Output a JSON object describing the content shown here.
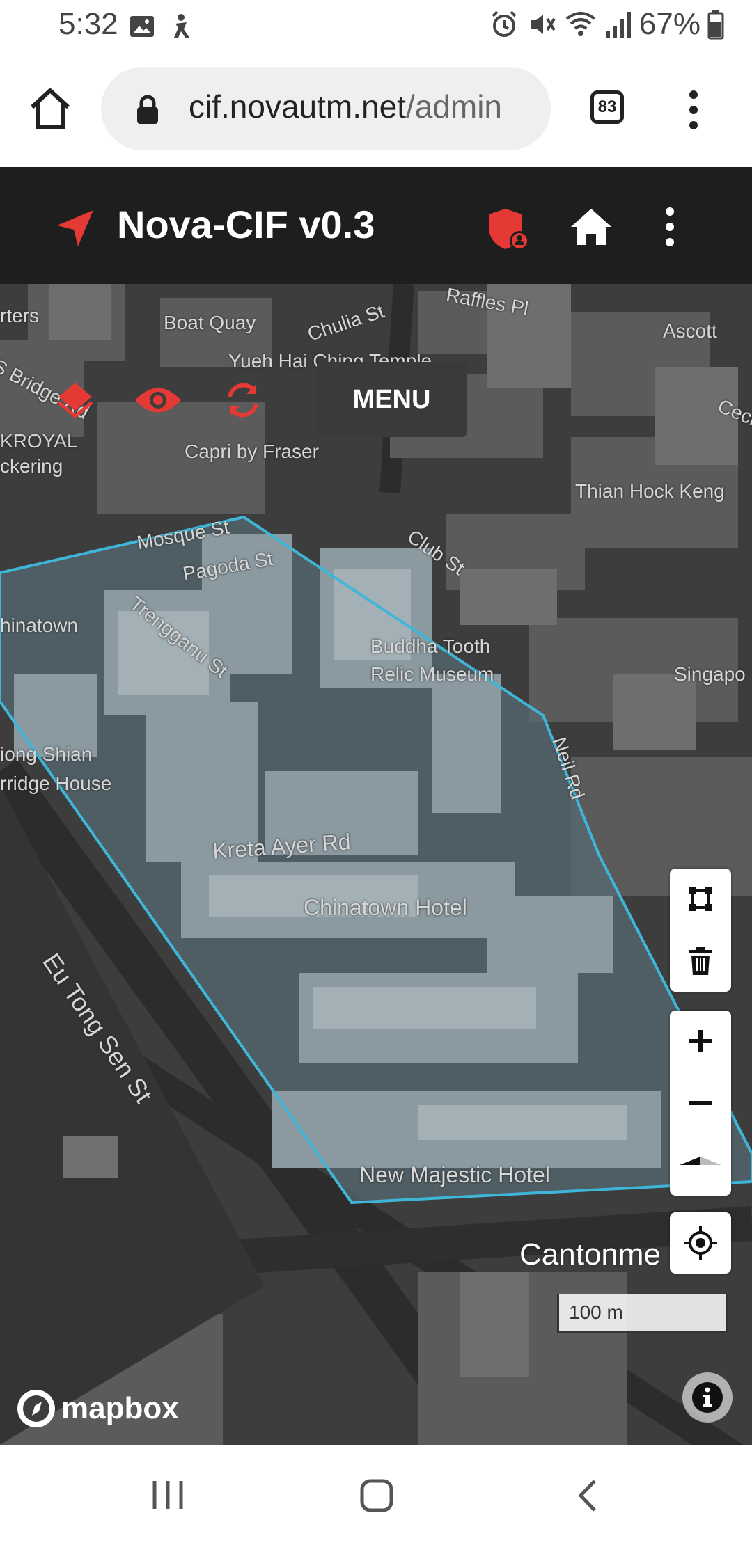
{
  "status_bar": {
    "time": "5:32",
    "battery": "67%",
    "icons": [
      "image-icon",
      "accessibility-icon",
      "alarm-icon",
      "mute-icon",
      "wifi-icon",
      "signal-icon",
      "battery-icon"
    ]
  },
  "browser": {
    "url_host": "cif.novautm.net",
    "url_path": "/admin",
    "tab_count": "83"
  },
  "app": {
    "title": "Nova-CIF v0.3",
    "accent": "#e53935"
  },
  "map": {
    "menu_label": "MENU",
    "scale_label": "100 m",
    "attribution": "mapbox",
    "zone_color": "#3fb6d8",
    "labels": {
      "boat_quay": "Boat Quay",
      "chulia_st": "Chulia St",
      "raffles_pl": "Raffles Pl",
      "ascott": "Ascott",
      "rters": "rters",
      "s_bridge_rd": "S Bridge Rd",
      "yueh_hai": "Yueh Hai Ching Temple",
      "kroyal": "KROYAL",
      "ckering": "ckering",
      "capri": "Capri by Fraser",
      "cecil": "Cecil",
      "thian_hock_keng": "Thian Hock Keng",
      "mosque_st": "Mosque St",
      "pagoda_st": "Pagoda St",
      "club_st": "Club St",
      "hinatown": "hinatown",
      "trengganu_st": "Trengganu St",
      "buddha_tooth_1": "Buddha Tooth",
      "buddha_tooth_2": "Relic Museum",
      "singapo": "Singapo",
      "neil_rd": "Neil Rd",
      "iong_shian": "iong Shian",
      "rridge_house": "rridge House",
      "kreta_ayer": "Kreta Ayer Rd",
      "chinatown_hotel": "Chinatown Hotel",
      "eu_tong_sen": "Eu Tong Sen St",
      "new_majestic": "New Majestic Hotel",
      "cantonment": "Cantonme"
    }
  },
  "nav_bar": {
    "items": [
      "recent-apps",
      "home",
      "back"
    ]
  }
}
